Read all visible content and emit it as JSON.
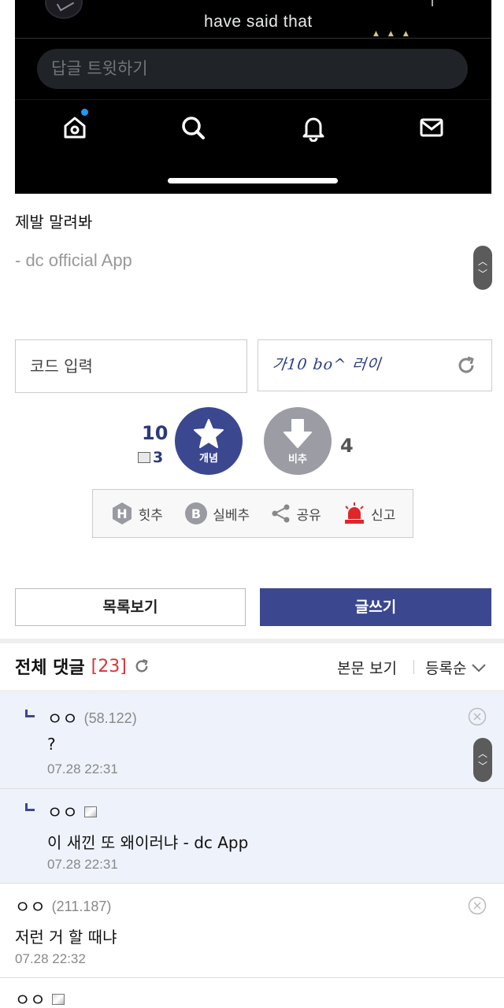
{
  "embed": {
    "tweet_text": "have said that",
    "reply_placeholder": "답글 트윗하기",
    "tabs": [
      "home-icon",
      "search-icon",
      "notifications-icon",
      "messages-icon"
    ]
  },
  "post": {
    "text": "제발 말려봐",
    "signature": "- dc official App"
  },
  "captcha": {
    "placeholder": "코드 입력",
    "image_text": "가10 bo^ 러이"
  },
  "recommend": {
    "up_count": "10",
    "up_fixed_count": "3",
    "up_label": "개념",
    "down_label": "비추",
    "down_count": "4"
  },
  "actions": [
    {
      "icon": "hit-icon",
      "label": "힛추"
    },
    {
      "icon": "best-icon",
      "label": "실베추"
    },
    {
      "icon": "share-icon",
      "label": "공유"
    },
    {
      "icon": "siren-icon",
      "label": "신고"
    }
  ],
  "buttons": {
    "list": "목록보기",
    "write": "글쓰기"
  },
  "comments_header": {
    "title": "전체 댓글",
    "count_open": "[",
    "count": "23",
    "count_close": "]",
    "body_view": "본문 보기",
    "sort": "등록순"
  },
  "comments": [
    {
      "author": "ㅇㅇ",
      "ip": "(58.122)",
      "content": "?",
      "date": "07.28 22:31"
    },
    {
      "author": "ㅇㅇ",
      "ip": "",
      "content": "이 새낀 또 왜이러냐 - dc App",
      "date": "07.28 22:31"
    },
    {
      "author": "ㅇㅇ",
      "ip": "(211.187)",
      "content": "저런 거 할 때냐",
      "date": "07.28 22:32"
    },
    {
      "author": "ㅇㅇ",
      "ip": "",
      "content": "",
      "date": ""
    }
  ],
  "colors": {
    "accent": "#3b4890",
    "count_red": "#d33333",
    "reply_bg": "#eef2fb"
  }
}
